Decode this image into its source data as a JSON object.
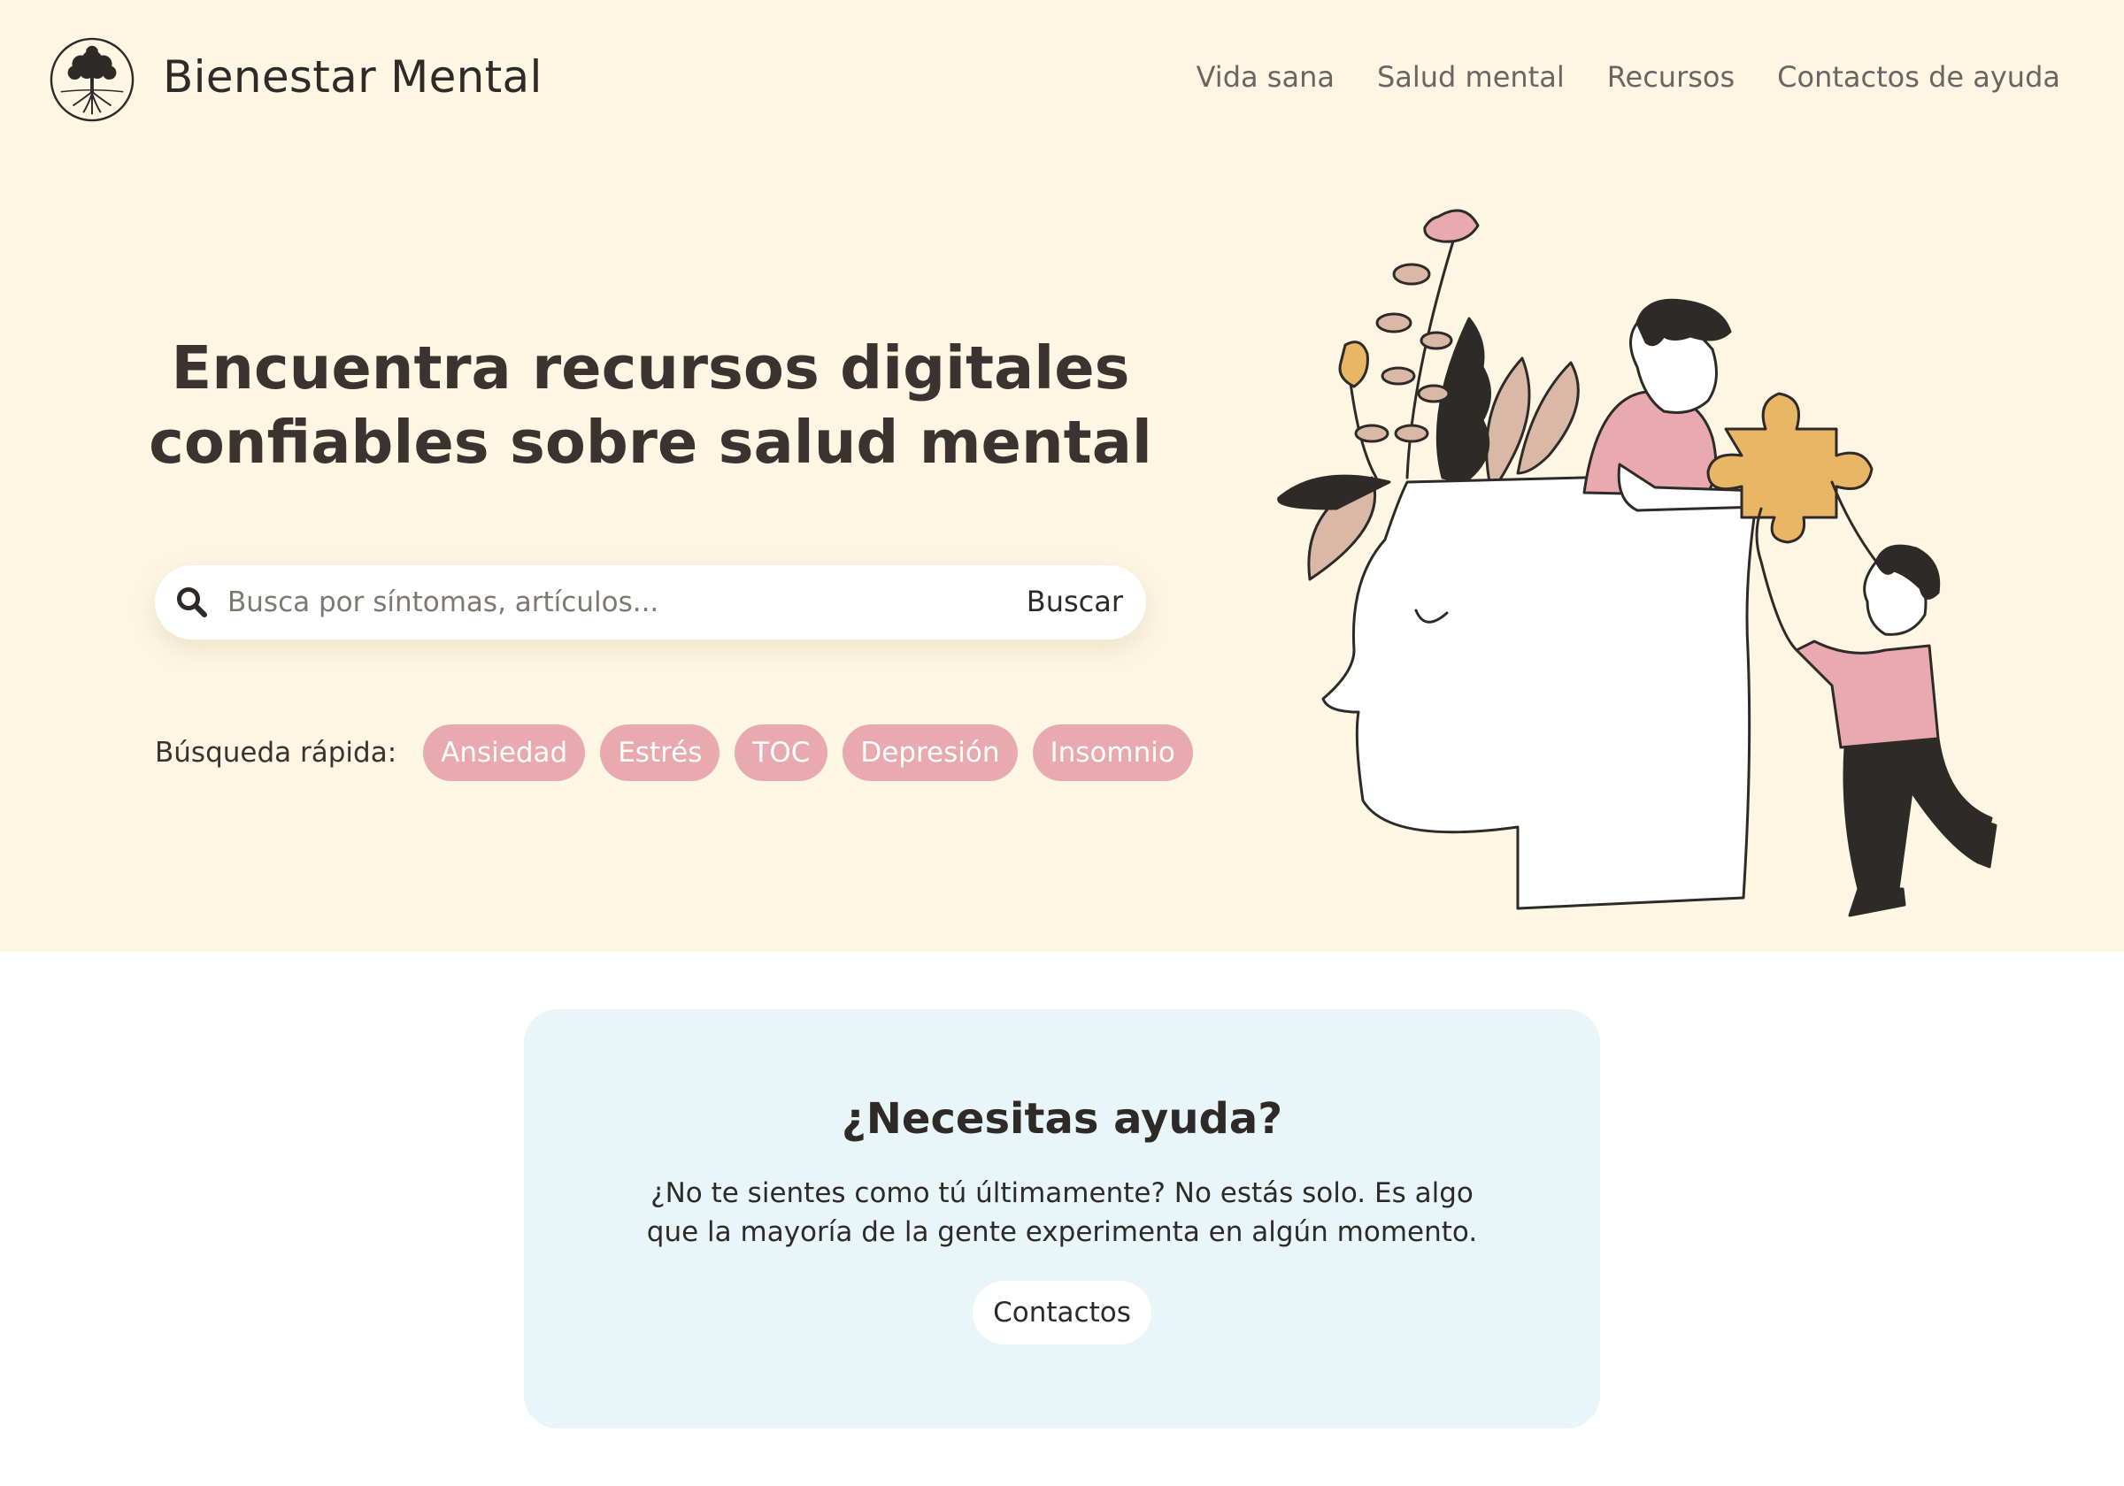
{
  "brand": {
    "name": "Bienestar Mental",
    "logo_icon": "tree-icon"
  },
  "nav": {
    "items": [
      {
        "label": "Vida sana"
      },
      {
        "label": "Salud mental"
      },
      {
        "label": "Recursos"
      },
      {
        "label": "Contactos de ayuda"
      }
    ]
  },
  "hero": {
    "title_line1": "Encuentra recursos digitales",
    "title_line2": "confiables sobre salud mental",
    "illustration": "people-building-mind-puzzle-illustration"
  },
  "search": {
    "icon": "search-icon",
    "placeholder": "Busca por síntomas, artículos...",
    "value": "",
    "button_label": "Buscar"
  },
  "quick_search": {
    "label": "Búsqueda rápida:",
    "tags": [
      {
        "label": "Ansiedad"
      },
      {
        "label": "Estrés"
      },
      {
        "label": "TOC"
      },
      {
        "label": "Depresión"
      },
      {
        "label": "Insomnio"
      }
    ]
  },
  "help": {
    "title": "¿Necesitas ayuda?",
    "body": "¿No te sientes como tú últimamente? No estás solo. Es algo que la mayoría de la gente experimenta en algún momento.",
    "button_label": "Contactos"
  },
  "colors": {
    "hero_background": "#fdf6e3",
    "tag_background": "#e8aaae",
    "card_background": "#e8f6fa",
    "accent_yellow": "#e8b664",
    "text_dark": "#2e2a27"
  }
}
